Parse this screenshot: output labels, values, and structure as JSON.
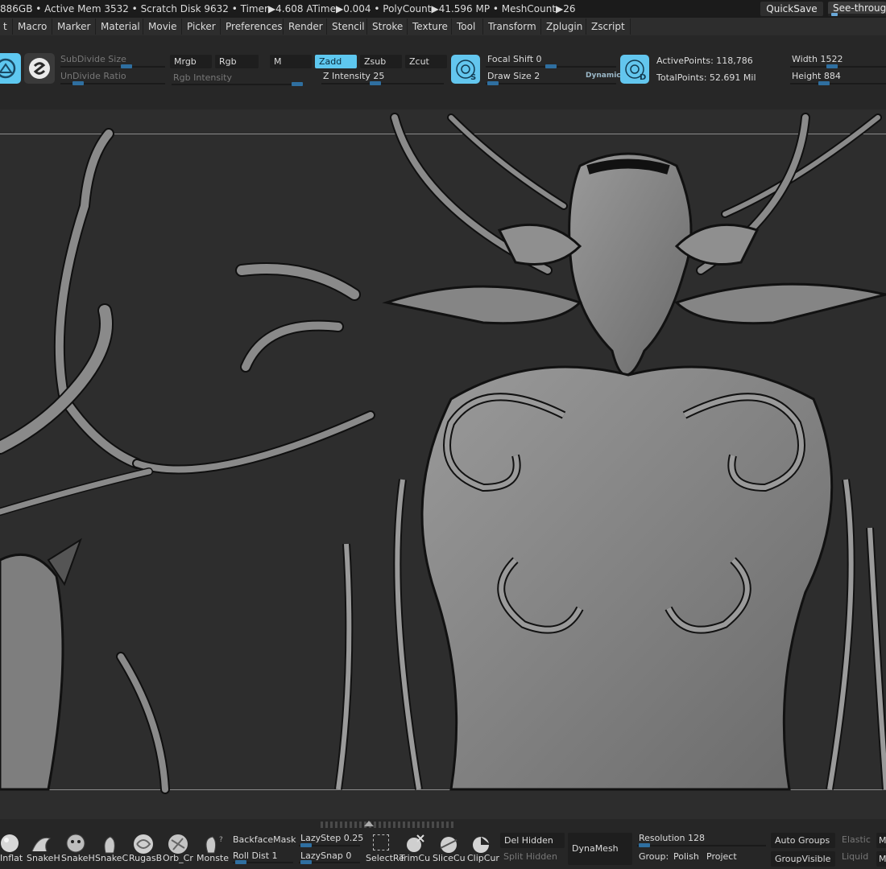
{
  "status_bar": {
    "text": "886GB • Active Mem 3532 • Scratch Disk 9632 •  Timer▶4.608 ATime▶0.004 • PolyCount▶41.596 MP  • MeshCount▶26",
    "quicksave": "QuickSave",
    "see_through": "See-through"
  },
  "menu": [
    "t",
    "Macro",
    "Marker",
    "Material",
    "Movie",
    "Picker",
    "Preferences",
    "Render",
    "Stencil",
    "Stroke",
    "Texture",
    "Tool",
    "Transform",
    "Zplugin",
    "Zscript"
  ],
  "toolbar": {
    "subdivide_size": "SubDivide Size",
    "undivide_ratio": "UnDivide Ratio",
    "mrgb": "Mrgb",
    "rgb": "Rgb",
    "m": "M",
    "rgb_intensity": "Rgb Intensity",
    "zadd": "Zadd",
    "zsub": "Zsub",
    "zcut": "Zcut",
    "z_intensity": "Z Intensity 25",
    "focal_shift": "Focal Shift 0",
    "draw_size": "Draw Size 2",
    "dynamic": "Dynamic",
    "active_points": "ActivePoints: 118,786",
    "total_points": "TotalPoints: 52.691 Mil",
    "width": "Width 1522",
    "height": "Height 884"
  },
  "shelf": {
    "brushes": [
      "Inflat",
      "SnakeH",
      "SnakeH",
      "SnakeC",
      "RugasB",
      "Orb_Cr",
      "Monste"
    ],
    "backface_mask": "BackfaceMask",
    "roll_dist": "Roll Dist 1",
    "lazy_step": "LazyStep 0.25",
    "lazy_snap": "LazySnap 0",
    "select_re": "SelectRe",
    "trim_cu": "TrimCu",
    "slice_cu": "SliceCu",
    "clip_cur": "ClipCur",
    "del_hidden": "Del Hidden",
    "split_hidden": "Split Hidden",
    "dynamesh": "DynaMesh",
    "resolution": "Resolution 128",
    "group": "Group:",
    "polish": "Polish",
    "project": "Project",
    "auto_groups": "Auto Groups",
    "group_visible": "GroupVisible",
    "elastic": "Elastic",
    "liquid": "Liquid",
    "m": "M"
  },
  "colors": {
    "accent": "#5ec8f0",
    "slider": "#2f6fa0",
    "background": "#2d2d2d"
  }
}
